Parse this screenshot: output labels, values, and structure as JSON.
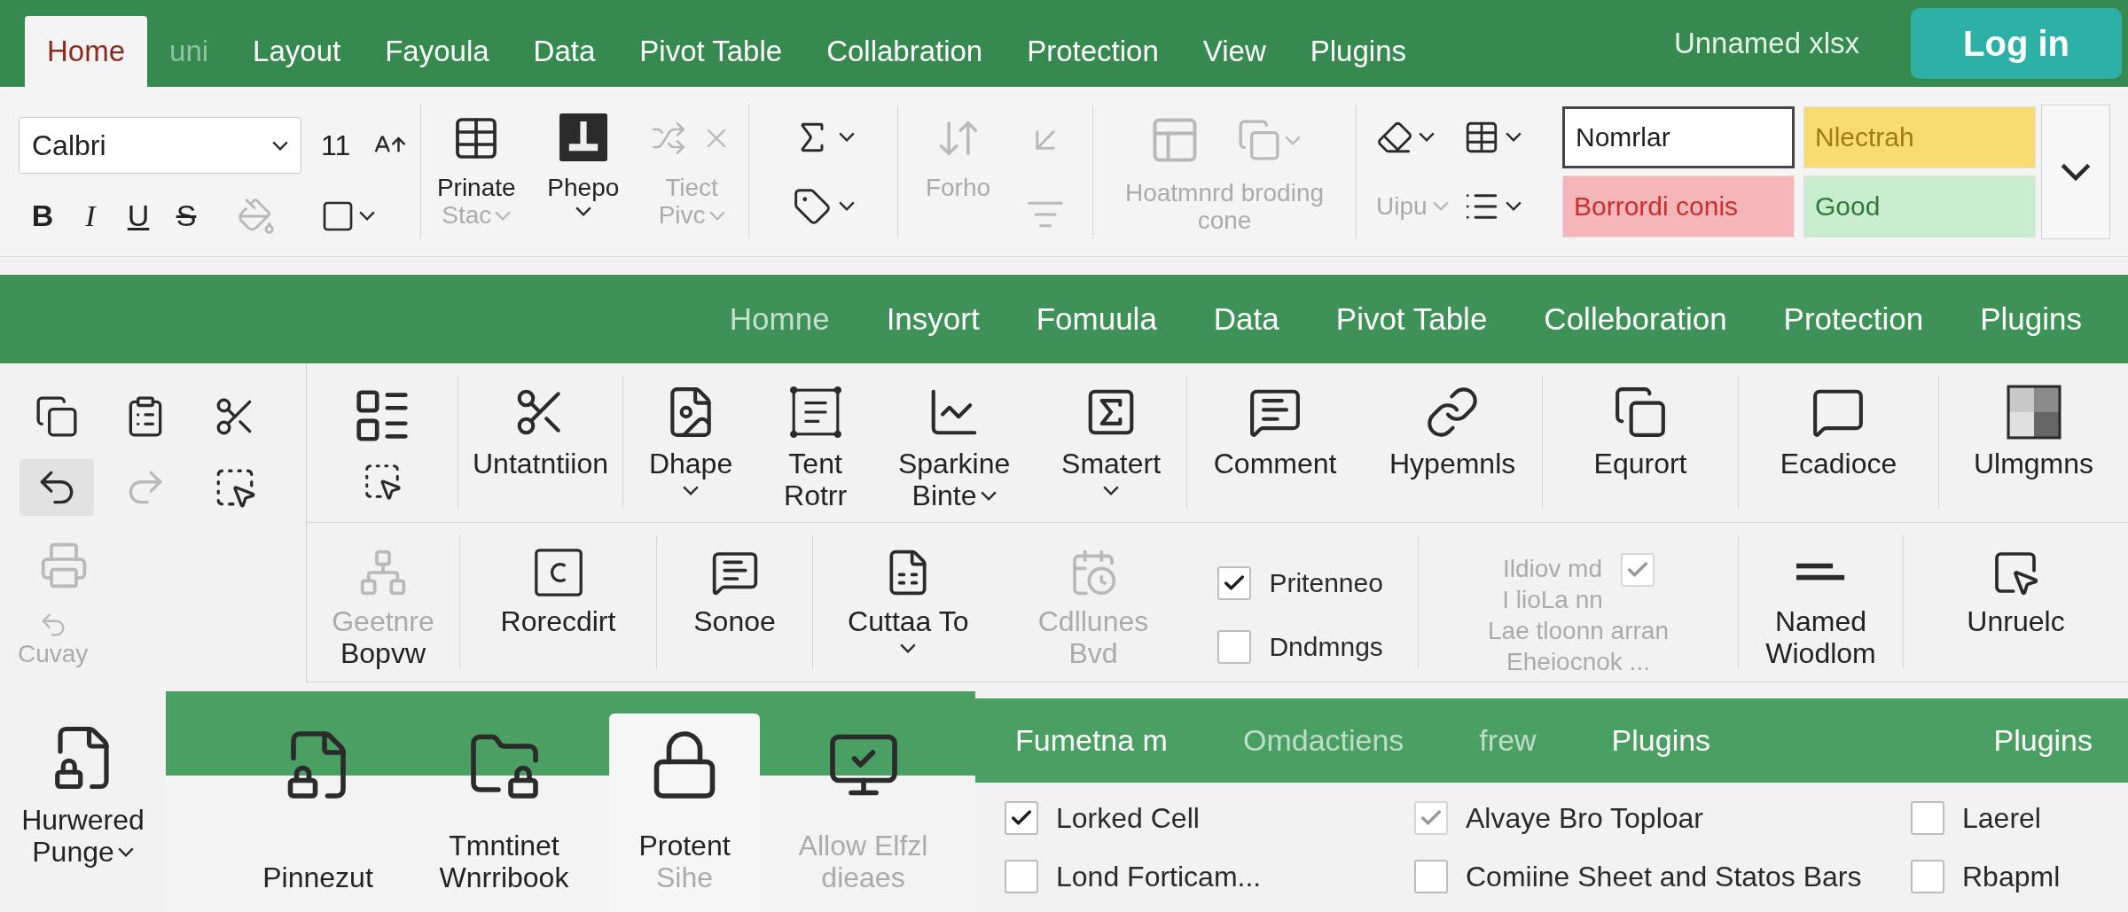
{
  "title_bar": {
    "tabs": [
      {
        "label": "Home",
        "selected": true,
        "disabled": false
      },
      {
        "label": "uni",
        "selected": false,
        "disabled": true
      },
      {
        "label": "Layout",
        "selected": false,
        "disabled": false
      },
      {
        "label": "Fayoula",
        "selected": false,
        "disabled": false
      },
      {
        "label": "Data",
        "selected": false,
        "disabled": false
      },
      {
        "label": "Pivot Table",
        "selected": false,
        "disabled": false
      },
      {
        "label": "Collabration",
        "selected": false,
        "disabled": false
      },
      {
        "label": "Protection",
        "selected": false,
        "disabled": false
      },
      {
        "label": "View",
        "selected": false,
        "disabled": false
      },
      {
        "label": "Plugins",
        "selected": false,
        "disabled": false
      }
    ],
    "file_name": "Unnamed xlsx",
    "login_button": "Log in"
  },
  "home_ribbon": {
    "font": {
      "value": "Calbri"
    },
    "font_size": "11",
    "format_buttons": [
      {
        "label": "B",
        "kind": "bold"
      },
      {
        "label": "I",
        "kind": "italic"
      },
      {
        "label": "U",
        "kind": "underline"
      },
      {
        "label": "S",
        "kind": "strike"
      }
    ],
    "fill_color": {
      "disabled": true
    },
    "border": {
      "disabled": false
    },
    "clipboard": [
      {
        "lines": [
          {
            "text": "Prinate",
            "disabled": false
          },
          {
            "text": "Stac",
            "disabled": true
          }
        ],
        "dropdown": true,
        "disabled": false
      },
      {
        "lines": [
          {
            "text": "Phepo",
            "disabled": false
          }
        ],
        "dropdown": true,
        "disabled": false
      },
      {
        "lines": [
          {
            "text": "Tiect",
            "disabled": true
          },
          {
            "text": "Pivc",
            "disabled": true
          }
        ],
        "dropdown": true,
        "disabled": true
      }
    ],
    "math_buttons": [
      {
        "disabled": false
      },
      {
        "disabled": false
      }
    ],
    "sort": {
      "lines": [
        {
          "text": "Forho",
          "disabled": true
        }
      ],
      "dropdown": false,
      "disabled": true
    },
    "sort_buttons": [
      {
        "disabled": true
      },
      {
        "disabled": true
      }
    ],
    "format": {
      "lines": [
        {
          "text": "Hoatmnrd broding",
          "disabled": true
        },
        {
          "text": "cone",
          "disabled": true
        }
      ],
      "dropdown": false,
      "disabled": true
    },
    "edit_buttons": [
      {
        "disabled": false
      },
      {
        "disabled": false
      },
      {
        "label": "Uipu",
        "disabled": true
      },
      {
        "disabled": false
      }
    ],
    "cell_styles": [
      {
        "label": "Nomrlar",
        "kind": "normal",
        "color": "#ffffff",
        "selected": true
      },
      {
        "label": "Nlectrah",
        "kind": "neutral",
        "color": "#f8dc72",
        "selected": false
      },
      {
        "label": "Borrordi conis",
        "kind": "bad",
        "color": "#f5b5b9",
        "selected": false
      },
      {
        "label": "Good",
        "kind": "good",
        "color": "#c9edcf",
        "selected": false
      }
    ]
  },
  "insert_tabs": [
    {
      "label": "Homne",
      "selected": false,
      "disabled": true
    },
    {
      "label": "Insyort",
      "selected": false,
      "disabled": false
    },
    {
      "label": "Fomuula",
      "selected": false,
      "disabled": false
    },
    {
      "label": "Data",
      "selected": false,
      "disabled": false
    },
    {
      "label": "Pivot Table",
      "selected": false,
      "disabled": false
    },
    {
      "label": "Colleboration",
      "selected": false,
      "disabled": false
    },
    {
      "label": "Protection",
      "selected": false,
      "disabled": false
    },
    {
      "label": "Plugins",
      "selected": false,
      "disabled": false
    }
  ],
  "insert_ribbon": {
    "quick_tools": [
      {
        "disabled": false,
        "pressed": false
      },
      {
        "disabled": false,
        "pressed": false
      },
      {
        "disabled": false,
        "pressed": false
      },
      {
        "disabled": false,
        "pressed": true
      },
      {
        "disabled": true,
        "pressed": false
      },
      {
        "disabled": false,
        "pressed": false
      }
    ],
    "side_tools": {
      "print": {
        "disabled": true
      },
      "undo": {
        "lines": [
          {
            "text": "Cuvay",
            "disabled": true
          }
        ],
        "dropdown": false,
        "disabled": true
      }
    },
    "top_groups": [
      {
        "items": [
          {
            "kind": "command",
            "lines": [
              {
                "text": "Untatntiion",
                "disabled": false
              }
            ],
            "dropdown": false,
            "disabled": false
          }
        ]
      },
      {
        "items": [
          {
            "kind": "command",
            "lines": [
              {
                "text": "Dhape",
                "disabled": false
              }
            ],
            "dropdown": true,
            "disabled": false
          },
          {
            "kind": "command",
            "lines": [
              {
                "text": "Tent",
                "disabled": false
              },
              {
                "text": "Rotrr",
                "disabled": false
              }
            ],
            "dropdown": false,
            "disabled": false
          },
          {
            "kind": "command",
            "lines": [
              {
                "text": "Sparkine",
                "disabled": false
              },
              {
                "text": "Binte",
                "disabled": false
              }
            ],
            "dropdown": true,
            "disabled": false
          },
          {
            "kind": "command",
            "lines": [
              {
                "text": "Smatert",
                "disabled": false
              }
            ],
            "dropdown": true,
            "disabled": false
          }
        ]
      },
      {
        "items": [
          {
            "kind": "command",
            "lines": [
              {
                "text": "Comment",
                "disabled": false
              }
            ],
            "dropdown": false,
            "disabled": false
          },
          {
            "kind": "command",
            "lines": [
              {
                "text": "Hypemnls",
                "disabled": false
              }
            ],
            "dropdown": false,
            "disabled": false
          }
        ]
      },
      {
        "items": [
          {
            "kind": "command",
            "lines": [
              {
                "text": "Equrort",
                "disabled": false
              }
            ],
            "dropdown": false,
            "disabled": false
          }
        ]
      },
      {
        "items": [
          {
            "kind": "command",
            "lines": [
              {
                "text": "Ecadioce",
                "disabled": false
              }
            ],
            "dropdown": false,
            "disabled": false
          }
        ]
      },
      {
        "items": [
          {
            "kind": "command",
            "lines": [
              {
                "text": "Ulmgmns",
                "disabled": false
              }
            ],
            "dropdown": false,
            "disabled": false
          }
        ]
      }
    ],
    "bottom_groups": [
      {
        "items": [
          {
            "kind": "command",
            "lines": [
              {
                "text": "Geetnre",
                "disabled": true
              },
              {
                "text": "Bopvw",
                "disabled": false
              }
            ],
            "dropdown": false,
            "disabled": true
          }
        ]
      },
      {
        "items": [
          {
            "kind": "command",
            "lines": [
              {
                "text": "Rorecdirt",
                "disabled": false
              }
            ],
            "dropdown": false,
            "disabled": false
          }
        ]
      },
      {
        "items": [
          {
            "kind": "command",
            "lines": [
              {
                "text": "Sonoe",
                "disabled": false
              }
            ],
            "dropdown": false,
            "disabled": false
          }
        ]
      },
      {
        "items": [
          {
            "kind": "command",
            "lines": [
              {
                "text": "Cuttaa To",
                "disabled": false
              }
            ],
            "dropdown": true,
            "disabled": false
          },
          {
            "kind": "command",
            "lines": [
              {
                "text": "Cdllunes",
                "disabled": true
              },
              {
                "text": "Bvd",
                "disabled": true
              }
            ],
            "dropdown": false,
            "disabled": true
          },
          {
            "kind": "checklist",
            "options": [
              {
                "label": "Pritenneo",
                "checked": true,
                "disabled": false
              },
              {
                "label": "Dndmngs",
                "checked": false,
                "disabled": false
              }
            ]
          }
        ]
      },
      {
        "items": [
          {
            "kind": "note",
            "lines": [
              {
                "text": "Ildiov md",
                "disabled": true
              },
              {
                "text": "I lioLa nn",
                "disabled": true
              },
              {
                "text": "Lae tloonn arran",
                "disabled": true
              },
              {
                "text": "Eheiocnok ...",
                "disabled": true
              }
            ],
            "check": {
              "checked": true,
              "disabled": true
            }
          }
        ]
      },
      {
        "items": [
          {
            "kind": "command",
            "lines": [
              {
                "text": "Named",
                "disabled": false
              },
              {
                "text": "Wiodlom",
                "disabled": false
              }
            ],
            "dropdown": false,
            "disabled": false
          }
        ]
      },
      {
        "items": [
          {
            "kind": "command",
            "lines": [
              {
                "text": "Unruelc",
                "disabled": false
              }
            ],
            "dropdown": false,
            "disabled": false
          }
        ]
      }
    ]
  },
  "bottom": {
    "page_setup": {
      "lines": [
        {
          "text": "Hurwered",
          "disabled": false
        },
        {
          "text": "Punge",
          "disabled": false
        }
      ],
      "dropdown": true,
      "disabled": false
    },
    "protect_tabs": [
      {
        "lines": [
          {
            "text": "Pinnezut",
            "disabled": false
          }
        ],
        "dropdown": false,
        "disabled": false,
        "selected": false
      },
      {
        "lines": [
          {
            "text": "Tmntinet",
            "disabled": false
          },
          {
            "text": "Wnrribook",
            "disabled": false
          }
        ],
        "dropdown": false,
        "disabled": false,
        "selected": false
      },
      {
        "lines": [
          {
            "text": "Protent",
            "disabled": false
          },
          {
            "text": "Sihe",
            "disabled": true
          }
        ],
        "dropdown": false,
        "disabled": false,
        "selected": true
      },
      {
        "lines": [
          {
            "text": "Allow Elfzl",
            "disabled": true
          },
          {
            "text": "dieaes",
            "disabled": true
          }
        ],
        "dropdown": false,
        "disabled": false,
        "selected": false
      }
    ],
    "view_tabs": [
      {
        "label": "Fumetna m",
        "selected": false,
        "disabled": false
      },
      {
        "label": "Omdactiens",
        "selected": false,
        "disabled": true
      },
      {
        "label": "frew",
        "selected": false,
        "disabled": true
      },
      {
        "label": "Plugins",
        "selected": false,
        "disabled": false
      },
      {
        "label": "Plugins",
        "selected": false,
        "disabled": false
      }
    ],
    "view_options": [
      {
        "options": [
          {
            "label": "Lorked Cell",
            "checked": true,
            "disabled": false
          },
          {
            "label": "Lond Forticam...",
            "checked": false,
            "disabled": false
          }
        ]
      },
      {
        "options": [
          {
            "label": "Alvaye Bro Toploar",
            "checked": true,
            "disabled": true
          },
          {
            "label": "Comiine Sheet and Statos Bars",
            "checked": false,
            "disabled": false
          }
        ]
      },
      {
        "options": [
          {
            "label": "Laerel",
            "checked": false,
            "disabled": false
          },
          {
            "label": "Rbapml",
            "checked": false,
            "disabled": false
          }
        ]
      }
    ]
  }
}
